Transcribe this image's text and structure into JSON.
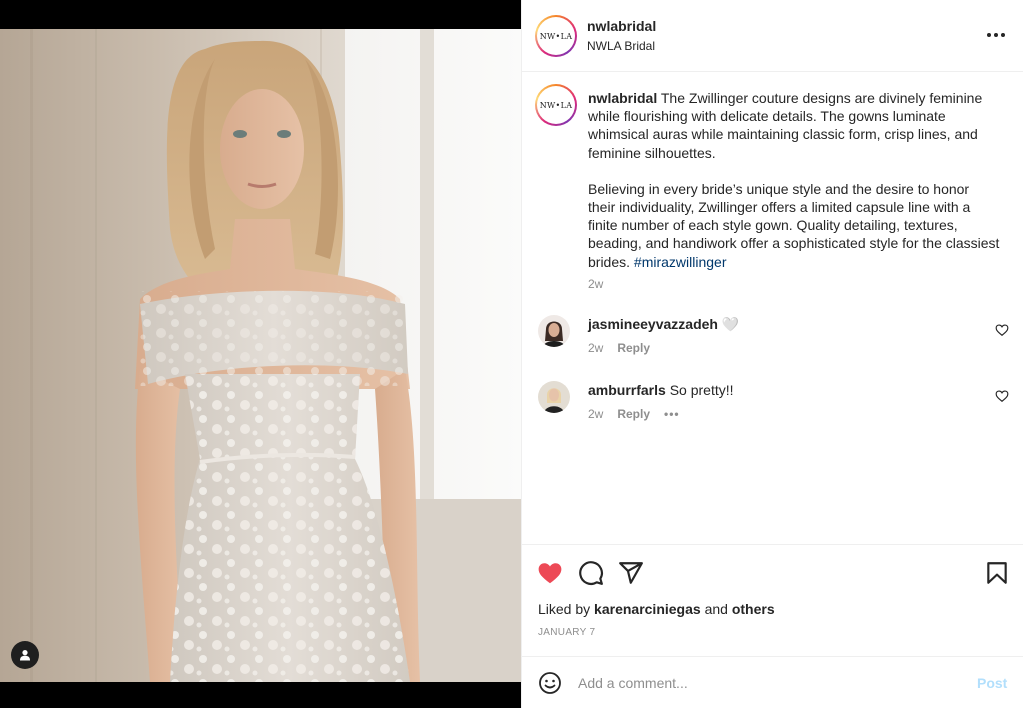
{
  "post": {
    "username": "nwlabridal",
    "display_name": "NWLA Bridal",
    "avatar_text": "NW•LA",
    "caption_p1": "The Zwillinger couture designs are divinely feminine while flourishing with delicate details. The gowns luminate whimsical auras while maintaining classic form, crisp lines, and feminine silhouettes.",
    "caption_p2": "Believing in every bride’s unique style and the desire to honor their individuality, Zwillinger offers a limited capsule line with a finite number of each style gown. Quality detailing, textures, beading, and handiwork offer a sophisticated style for the classiest brides.",
    "hashtag": "#mirazwillinger",
    "caption_time": "2w"
  },
  "comments": [
    {
      "username": "jasmineeyvazzadeh",
      "text": "🤍",
      "time": "2w",
      "reply_label": "Reply"
    },
    {
      "username": "amburrfarls",
      "text": "So pretty!!",
      "time": "2w",
      "reply_label": "Reply",
      "more": "•••"
    }
  ],
  "likes": {
    "prefix": "Liked by",
    "user": "karenarciniegas",
    "and": "and",
    "others": "others"
  },
  "date": "JANUARY 7",
  "add_comment": {
    "placeholder": "Add a comment...",
    "post_label": "Post"
  },
  "icons": {
    "like": "heart-filled-icon",
    "comment": "comment-bubble-icon",
    "share": "paper-plane-icon",
    "save": "bookmark-icon",
    "emoji": "smiley-icon",
    "more": "more-dots-icon",
    "user_tag": "person-icon"
  },
  "colors": {
    "like_red": "#ed4956",
    "link_blue": "#00376b",
    "post_disabled": "#b2dffc",
    "muted": "#8e8e8e"
  }
}
